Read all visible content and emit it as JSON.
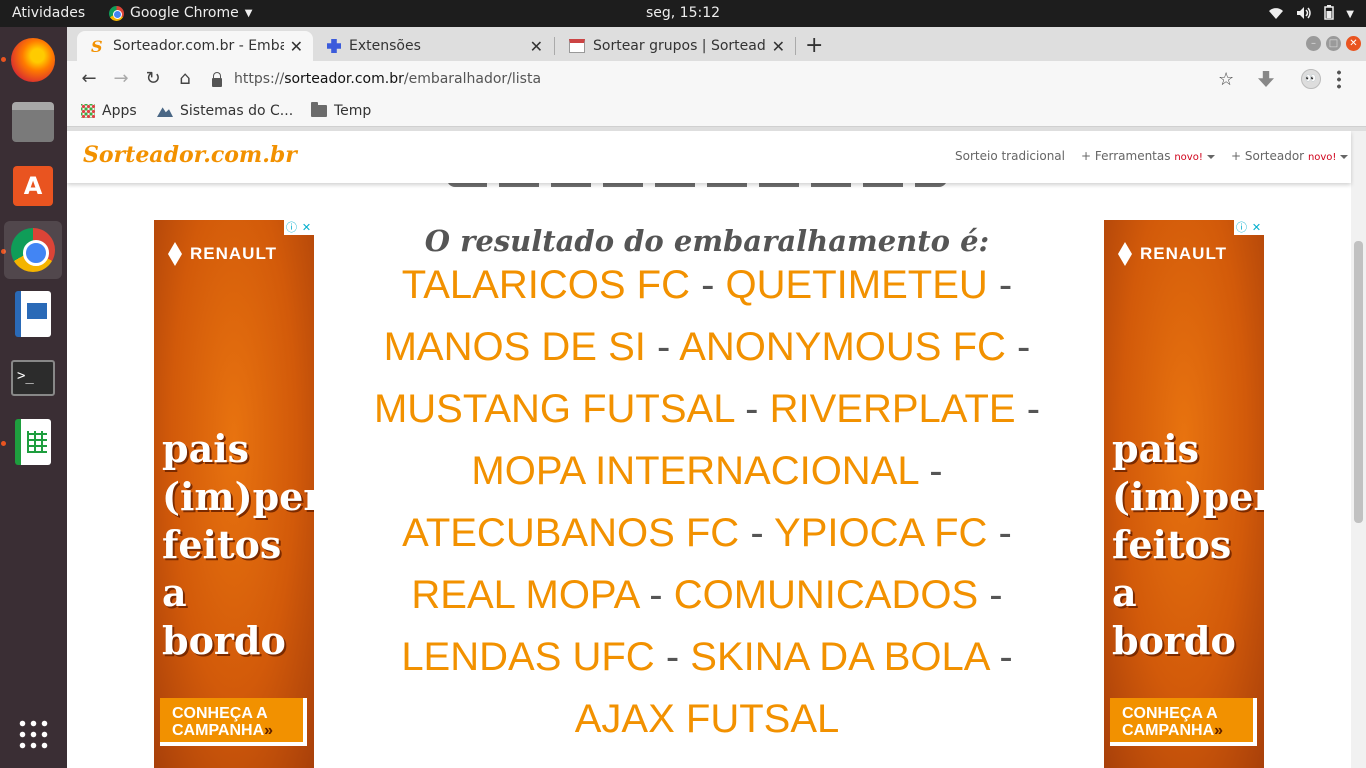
{
  "topbar": {
    "activities": "Atividades",
    "app_name": "Google Chrome",
    "clock": "seg, 15:12"
  },
  "dock": {
    "items": [
      "firefox",
      "files",
      "software-center",
      "chrome",
      "libreoffice-writer",
      "terminal",
      "libreoffice-calc",
      "show-applications"
    ]
  },
  "tabs": [
    {
      "title": "Sorteador.com.br - Embaralhador",
      "active": true
    },
    {
      "title": "Extensões",
      "active": false
    },
    {
      "title": "Sortear grupos | Sorteador",
      "active": false
    }
  ],
  "toolbar": {
    "url_scheme": "https://",
    "url_host": "sorteador.com.br",
    "url_path": "/embaralhador/lista"
  },
  "bookmarks": [
    {
      "label": "Apps",
      "icon": "apps-grid-icon"
    },
    {
      "label": "Sistemas do C...",
      "icon": "mountain-icon"
    },
    {
      "label": "Temp",
      "icon": "folder-icon"
    }
  ],
  "site": {
    "logo": "Sorteador.com.br",
    "nav": [
      {
        "label": "Sorteio tradicional",
        "badge": ""
      },
      {
        "label": "+ Ferramentas",
        "badge": "novo!"
      },
      {
        "label": "+ Sorteador",
        "badge": "novo!"
      }
    ],
    "result_title": "O resultado do embaralhamento é:",
    "separator": "-",
    "lines": [
      [
        "TALARICOS FC",
        "QUETIMETEU"
      ],
      [
        "MANOS DE SI",
        "ANONYMOUS FC"
      ],
      [
        "MUSTANG FUTSAL",
        "RIVERPLATE"
      ],
      [
        "MOPA INTERNACIONAL"
      ],
      [
        "ATECUBANOS FC",
        "YPIOCA FC"
      ],
      [
        "REAL MOPA",
        "COMUNICADOS"
      ],
      [
        "LENDAS UFC",
        "SKINA DA BOLA"
      ],
      [
        "AJAX FUTSAL"
      ]
    ]
  },
  "ad": {
    "brand": "RENAULT",
    "slogan_lines": [
      "pais",
      "(im)per-",
      "feitos",
      "a bordo"
    ],
    "cta_lines": [
      "CONHEÇA A",
      "CAMPANHA"
    ],
    "cta_arrow": "»",
    "info": "ⓘ",
    "close": "✕"
  },
  "colors": {
    "brand_orange": "#f29100",
    "separator_gray": "#555555",
    "ubuntu_orange": "#e95420"
  }
}
